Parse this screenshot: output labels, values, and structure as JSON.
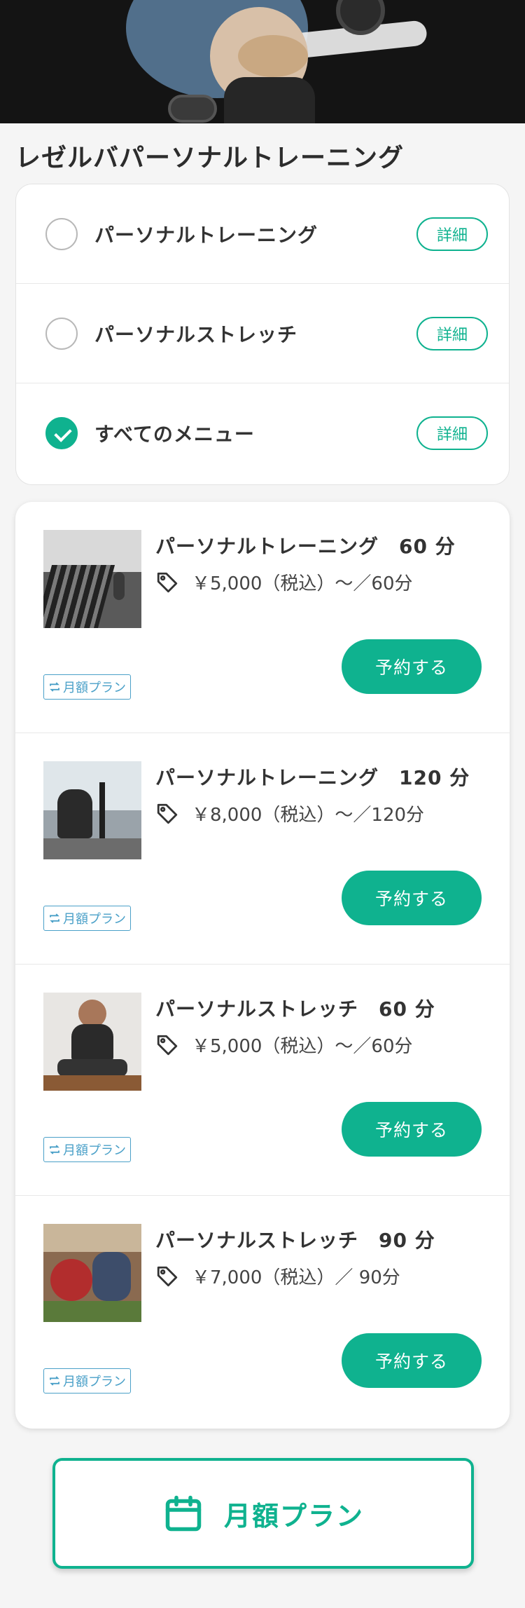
{
  "page_title": "レゼルバパーソナルトレーニング",
  "filters": [
    {
      "label": "パーソナルトレーニング",
      "checked": false,
      "detail_label": "詳細"
    },
    {
      "label": "パーソナルストレッチ",
      "checked": false,
      "detail_label": "詳細"
    },
    {
      "label": "すべてのメニュー",
      "checked": true,
      "detail_label": "詳細"
    }
  ],
  "menu_items": [
    {
      "name": "パーソナルトレーニング　60 分",
      "price": "￥5,000（税込）〜／60分",
      "reserve_label": "予約する",
      "plan_badge": "月額プラン"
    },
    {
      "name": "パーソナルトレーニング　120 分",
      "price": "￥8,000（税込）〜／120分",
      "reserve_label": "予約する",
      "plan_badge": "月額プラン"
    },
    {
      "name": "パーソナルストレッチ　60 分",
      "price": "￥5,000（税込）〜／60分",
      "reserve_label": "予約する",
      "plan_badge": "月額プラン"
    },
    {
      "name": "パーソナルストレッチ　90 分",
      "price": "￥7,000（税込）／ 90分",
      "reserve_label": "予約する",
      "plan_badge": "月額プラン"
    }
  ],
  "monthly_plan_button": {
    "label": "月額プラン",
    "icon": "calendar-icon"
  },
  "colors": {
    "accent": "#0fb28f",
    "badge": "#4aa0c8"
  }
}
